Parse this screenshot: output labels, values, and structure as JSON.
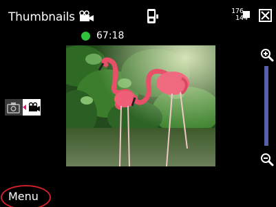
{
  "header": {
    "title": "Thumbnails",
    "resolution_width": "176",
    "resolution_height": "144"
  },
  "recording": {
    "status_color": "#2fc23a",
    "remaining_time": "67:18"
  },
  "icons": {
    "mode": "video-camera-icon",
    "device": "phone-storage-icon",
    "close": "close-icon",
    "zoom_in": "zoom-in-icon",
    "zoom_out": "zoom-out-icon",
    "photo_mode": "camera-icon",
    "video_mode": "video-camera-icon"
  },
  "softkeys": {
    "left": "Menu"
  },
  "preview": {
    "subject": "two flamingos in green foliage"
  },
  "colors": {
    "zoom_track": "#5560a8",
    "menu_highlight": "#d0202c"
  }
}
